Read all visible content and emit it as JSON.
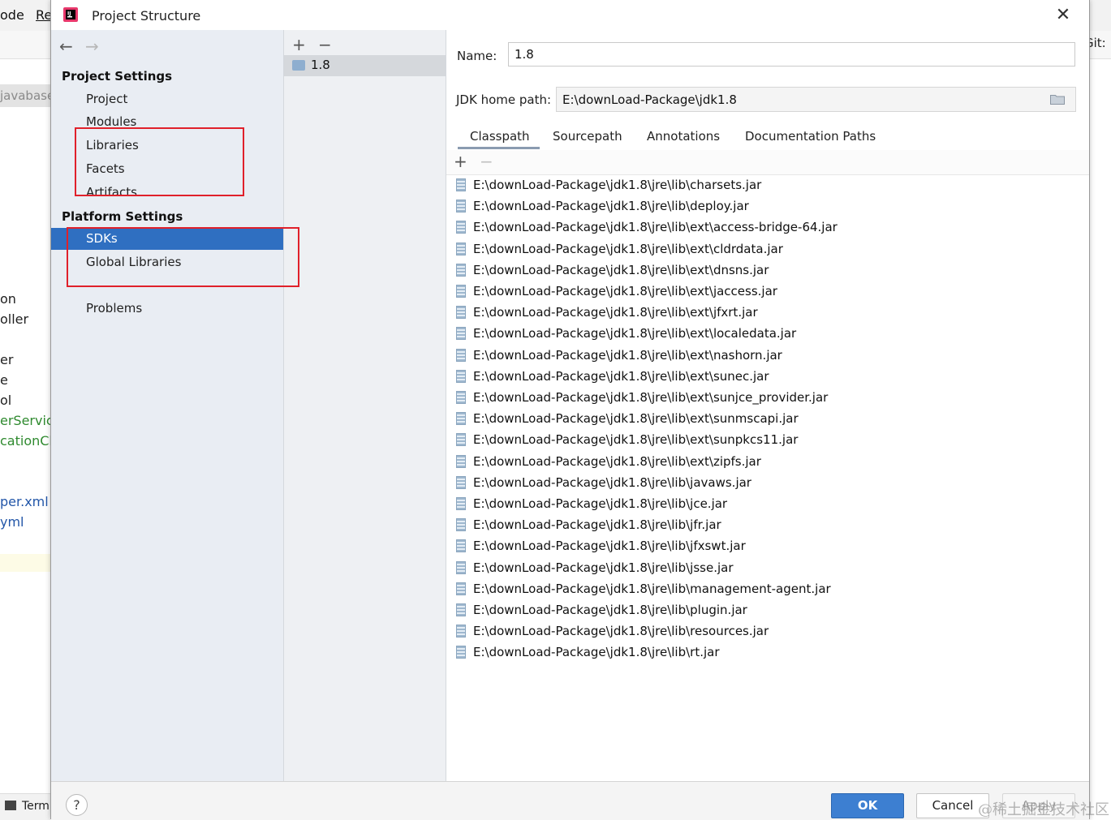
{
  "ide": {
    "menu_items": [
      "ode",
      "Re"
    ],
    "left_tab": "javabase",
    "files": [
      {
        "label": "on",
        "color": "#1f1f1f"
      },
      {
        "label": "oller",
        "color": "#1f1f1f"
      },
      {
        "label": "er",
        "color": "#1f1f1f"
      },
      {
        "label": "e",
        "color": "#1f1f1f"
      },
      {
        "label": "ol",
        "color": "#1f1f1f"
      },
      {
        "label": "erService",
        "color": "#2f8a2f"
      },
      {
        "label": "cationClie",
        "color": "#2f8a2f"
      },
      {
        "label": "per.xml",
        "color": "#2256a8"
      },
      {
        "label": "yml",
        "color": "#2256a8"
      }
    ],
    "bottom_tab": "Termi",
    "right_label": "Git:"
  },
  "dialog": {
    "title": "Project Structure",
    "close_icon": "close-icon",
    "nav": {
      "back_icon": "arrow-left-icon",
      "forward_icon": "arrow-right-icon",
      "project_settings_header": "Project Settings",
      "project_settings": [
        "Project",
        "Modules",
        "Libraries",
        "Facets",
        "Artifacts"
      ],
      "platform_settings_header": "Platform Settings",
      "platform_settings": [
        "SDKs",
        "Global Libraries"
      ],
      "selected": "SDKs",
      "problems": "Problems"
    },
    "sdk_list": {
      "add_icon": "plus-icon",
      "remove_icon": "minus-icon",
      "items": [
        "1.8"
      ]
    },
    "detail": {
      "name_label": "Name:",
      "name_value": "1.8",
      "jdk_home_label": "JDK home path:",
      "jdk_home_value": "E:\\downLoad-Package\\jdk1.8",
      "tabs": [
        "Classpath",
        "Sourcepath",
        "Annotations",
        "Documentation Paths"
      ],
      "active_tab": "Classpath",
      "classpath": [
        "E:\\downLoad-Package\\jdk1.8\\jre\\lib\\charsets.jar",
        "E:\\downLoad-Package\\jdk1.8\\jre\\lib\\deploy.jar",
        "E:\\downLoad-Package\\jdk1.8\\jre\\lib\\ext\\access-bridge-64.jar",
        "E:\\downLoad-Package\\jdk1.8\\jre\\lib\\ext\\cldrdata.jar",
        "E:\\downLoad-Package\\jdk1.8\\jre\\lib\\ext\\dnsns.jar",
        "E:\\downLoad-Package\\jdk1.8\\jre\\lib\\ext\\jaccess.jar",
        "E:\\downLoad-Package\\jdk1.8\\jre\\lib\\ext\\jfxrt.jar",
        "E:\\downLoad-Package\\jdk1.8\\jre\\lib\\ext\\localedata.jar",
        "E:\\downLoad-Package\\jdk1.8\\jre\\lib\\ext\\nashorn.jar",
        "E:\\downLoad-Package\\jdk1.8\\jre\\lib\\ext\\sunec.jar",
        "E:\\downLoad-Package\\jdk1.8\\jre\\lib\\ext\\sunjce_provider.jar",
        "E:\\downLoad-Package\\jdk1.8\\jre\\lib\\ext\\sunmscapi.jar",
        "E:\\downLoad-Package\\jdk1.8\\jre\\lib\\ext\\sunpkcs11.jar",
        "E:\\downLoad-Package\\jdk1.8\\jre\\lib\\ext\\zipfs.jar",
        "E:\\downLoad-Package\\jdk1.8\\jre\\lib\\javaws.jar",
        "E:\\downLoad-Package\\jdk1.8\\jre\\lib\\jce.jar",
        "E:\\downLoad-Package\\jdk1.8\\jre\\lib\\jfr.jar",
        "E:\\downLoad-Package\\jdk1.8\\jre\\lib\\jfxswt.jar",
        "E:\\downLoad-Package\\jdk1.8\\jre\\lib\\jsse.jar",
        "E:\\downLoad-Package\\jdk1.8\\jre\\lib\\management-agent.jar",
        "E:\\downLoad-Package\\jdk1.8\\jre\\lib\\plugin.jar",
        "E:\\downLoad-Package\\jdk1.8\\jre\\lib\\resources.jar",
        "E:\\downLoad-Package\\jdk1.8\\jre\\lib\\rt.jar"
      ]
    },
    "footer": {
      "help_label": "?",
      "ok_label": "OK",
      "cancel_label": "Cancel",
      "apply_label": "Apply",
      "watermark": "@稀土掘金技术社区"
    },
    "colors": {
      "selection": "#2f6fc1",
      "ok_button": "#3d7fd1",
      "annotation_box": "#e0202a"
    }
  }
}
